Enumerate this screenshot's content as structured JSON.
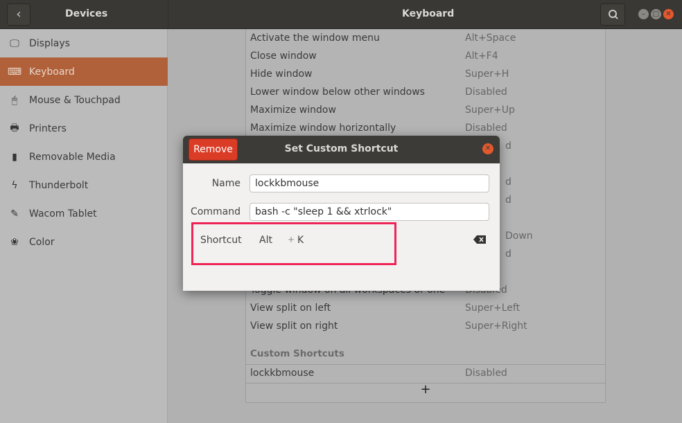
{
  "header": {
    "left_title": "Devices",
    "title": "Keyboard"
  },
  "sidebar": {
    "items": [
      {
        "label": "Displays",
        "icon": "display-icon",
        "glyph": "🖵"
      },
      {
        "label": "Keyboard",
        "icon": "keyboard-icon",
        "glyph": "⌨",
        "selected": true
      },
      {
        "label": "Mouse & Touchpad",
        "icon": "mouse-icon",
        "glyph": "🖱"
      },
      {
        "label": "Printers",
        "icon": "printer-icon",
        "glyph": "🖶"
      },
      {
        "label": "Removable Media",
        "icon": "usb-icon",
        "glyph": "▮"
      },
      {
        "label": "Thunderbolt",
        "icon": "thunderbolt-icon",
        "glyph": "ϟ"
      },
      {
        "label": "Wacom Tablet",
        "icon": "tablet-icon",
        "glyph": "✎"
      },
      {
        "label": "Color",
        "icon": "color-icon",
        "glyph": "❀"
      }
    ]
  },
  "shortcuts": [
    {
      "label": "Activate the window menu",
      "shortcut": "Alt+Space"
    },
    {
      "label": "Close window",
      "shortcut": "Alt+F4"
    },
    {
      "label": "Hide window",
      "shortcut": "Super+H"
    },
    {
      "label": "Lower window below other windows",
      "shortcut": "Disabled"
    },
    {
      "label": "Maximize window",
      "shortcut": "Super+Up"
    },
    {
      "label": "Maximize window horizontally",
      "shortcut": "Disabled"
    },
    {
      "label": "",
      "shortcut": "d"
    },
    {
      "label": "",
      "shortcut": ""
    },
    {
      "label": "",
      "shortcut": "d"
    },
    {
      "label": "",
      "shortcut": "d"
    },
    {
      "label": "",
      "shortcut": ""
    },
    {
      "label": "",
      "shortcut": "Down"
    },
    {
      "label": "",
      "shortcut": "d"
    },
    {
      "label": "",
      "shortcut": ""
    },
    {
      "label": "Toggle window on all workspaces or one",
      "shortcut": "Disabled"
    },
    {
      "label": "View split on left",
      "shortcut": "Super+Left"
    },
    {
      "label": "View split on right",
      "shortcut": "Super+Right"
    }
  ],
  "custom": {
    "title": "Custom Shortcuts",
    "items": [
      {
        "label": "lockkbmouse",
        "shortcut": "Disabled"
      }
    ],
    "add": "+"
  },
  "dialog": {
    "title": "Set Custom Shortcut",
    "remove": "Remove",
    "name_label": "Name",
    "name_value": "lockkbmouse",
    "command_label": "Command",
    "command_value": "bash -c \"sleep 1 && xtrlock\"",
    "shortcut_label": "Shortcut",
    "mod": "Alt",
    "plus": "+",
    "key": "K"
  },
  "colors": {
    "accent": "#b0613a",
    "remove": "#db3c26",
    "highlight": "#ee2457"
  }
}
